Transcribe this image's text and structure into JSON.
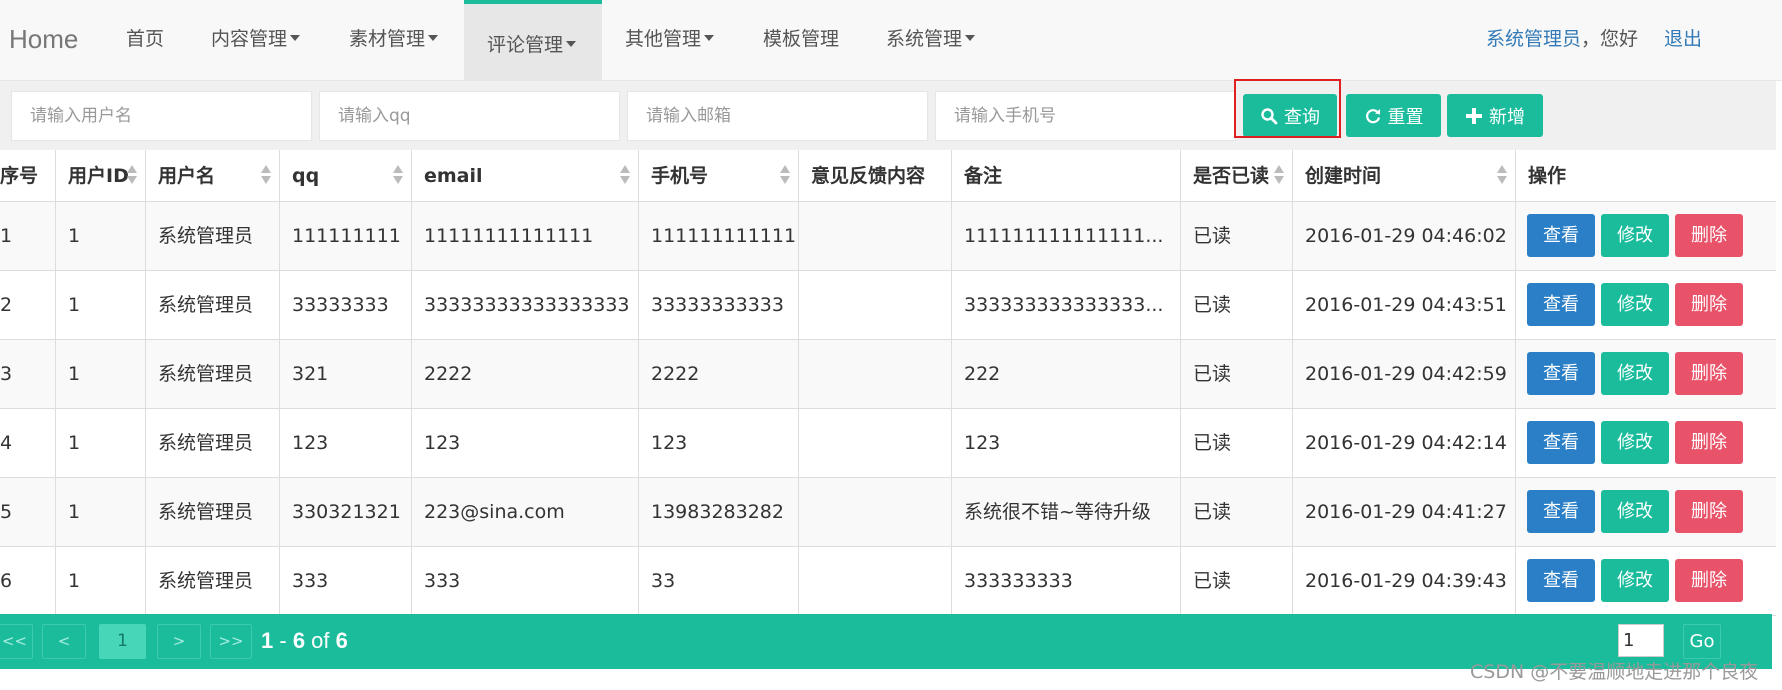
{
  "nav": {
    "brand": "Home",
    "items": [
      {
        "label": "首页",
        "dropdown": false
      },
      {
        "label": "内容管理",
        "dropdown": true
      },
      {
        "label": "素材管理",
        "dropdown": true
      },
      {
        "label": "评论管理",
        "dropdown": true,
        "active": true
      },
      {
        "label": "其他管理",
        "dropdown": true
      },
      {
        "label": "模板管理",
        "dropdown": false
      },
      {
        "label": "系统管理",
        "dropdown": true
      }
    ],
    "user_name": "系统管理员",
    "greeting": "，您好",
    "logout": "退出"
  },
  "filters": {
    "username_placeholder": "请输入用户名",
    "qq_placeholder": "请输入qq",
    "email_placeholder": "请输入邮箱",
    "phone_placeholder": "请输入手机号",
    "search_label": "查询",
    "reset_label": "重置",
    "add_label": "新增"
  },
  "table": {
    "columns": [
      "序号",
      "用户ID",
      "用户名",
      "qq",
      "email",
      "手机号",
      "意见反馈内容",
      "备注",
      "是否已读",
      "创建时间",
      "操作"
    ],
    "rows": [
      {
        "index": "1",
        "user_id": "1",
        "username": "系统管理员",
        "qq": "111111111",
        "email": "11111111111111",
        "phone": "1111111111111",
        "feedback": "",
        "remark": "111111111111111...",
        "read": "已读",
        "created": "2016-01-29 04:46:02"
      },
      {
        "index": "2",
        "user_id": "1",
        "username": "系统管理员",
        "qq": "33333333",
        "email": "33333333333333333",
        "phone": "33333333333",
        "feedback": "",
        "remark": "333333333333333...",
        "read": "已读",
        "created": "2016-01-29 04:43:51"
      },
      {
        "index": "3",
        "user_id": "1",
        "username": "系统管理员",
        "qq": "321",
        "email": "2222",
        "phone": "2222",
        "feedback": "",
        "remark": "222",
        "read": "已读",
        "created": "2016-01-29 04:42:59"
      },
      {
        "index": "4",
        "user_id": "1",
        "username": "系统管理员",
        "qq": "123",
        "email": "123",
        "phone": "123",
        "feedback": "",
        "remark": "123",
        "read": "已读",
        "created": "2016-01-29 04:42:14"
      },
      {
        "index": "5",
        "user_id": "1",
        "username": "系统管理员",
        "qq": "330321321",
        "email": "223@sina.com",
        "phone": "13983283282",
        "feedback": "",
        "remark": "系统很不错~等待升级",
        "read": "已读",
        "created": "2016-01-29 04:41:27"
      },
      {
        "index": "6",
        "user_id": "1",
        "username": "系统管理员",
        "qq": "333",
        "email": "333",
        "phone": "33",
        "feedback": "",
        "remark": "333333333",
        "read": "已读",
        "created": "2016-01-29 04:39:43"
      }
    ],
    "actions": {
      "view": "查看",
      "edit": "修改",
      "delete": "删除"
    }
  },
  "pager": {
    "first": "<<",
    "prev": "<",
    "current": "1",
    "next": ">",
    "last": ">>",
    "range_start": "1",
    "dash": " - ",
    "range_end": "6",
    "of": " of ",
    "total": "6",
    "goto_value": "1",
    "go_label": "Go"
  },
  "watermark": "CSDN @不要温顺地走进那个良夜",
  "colors": {
    "accent": "#1abc9c",
    "primary": "#2a7fc6",
    "danger": "#e9536a",
    "highlight": "#e02020"
  }
}
